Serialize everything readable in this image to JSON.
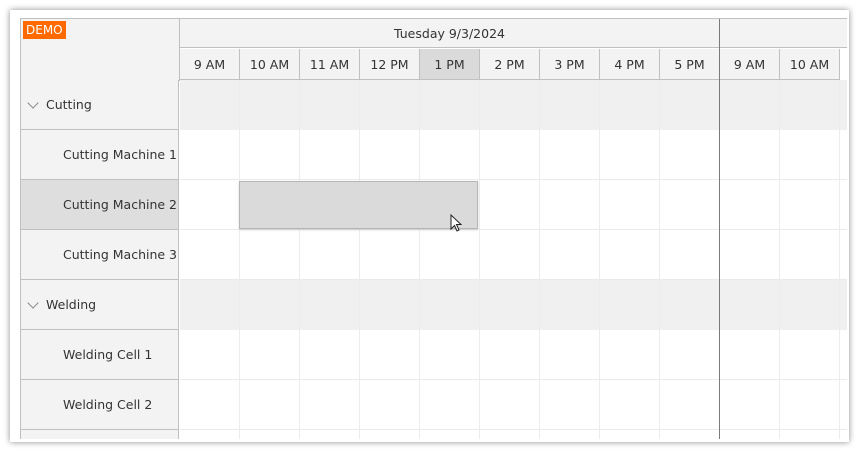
{
  "demo_badge": "DEMO",
  "days": [
    {
      "label": "Tuesday 9/3/2024"
    },
    {
      "label": ""
    }
  ],
  "hours": [
    "9 AM",
    "10 AM",
    "11 AM",
    "12 PM",
    "1 PM",
    "2 PM",
    "3 PM",
    "4 PM",
    "5 PM",
    "9 AM",
    "10 AM"
  ],
  "rows": [
    {
      "type": "group",
      "label": "Cutting"
    },
    {
      "type": "resource",
      "label": "Cutting Machine 1"
    },
    {
      "type": "resource",
      "label": "Cutting Machine 2"
    },
    {
      "type": "resource",
      "label": "Cutting Machine 3"
    },
    {
      "type": "group",
      "label": "Welding"
    },
    {
      "type": "resource",
      "label": "Welding Cell 1"
    },
    {
      "type": "resource",
      "label": "Welding Cell 2"
    }
  ],
  "selected_hour": "1 PM",
  "selected_row": "Cutting Machine 2",
  "colors": {
    "accent": "#ff6a00",
    "header_bg": "#f3f3f3",
    "selection": "#dadada"
  }
}
